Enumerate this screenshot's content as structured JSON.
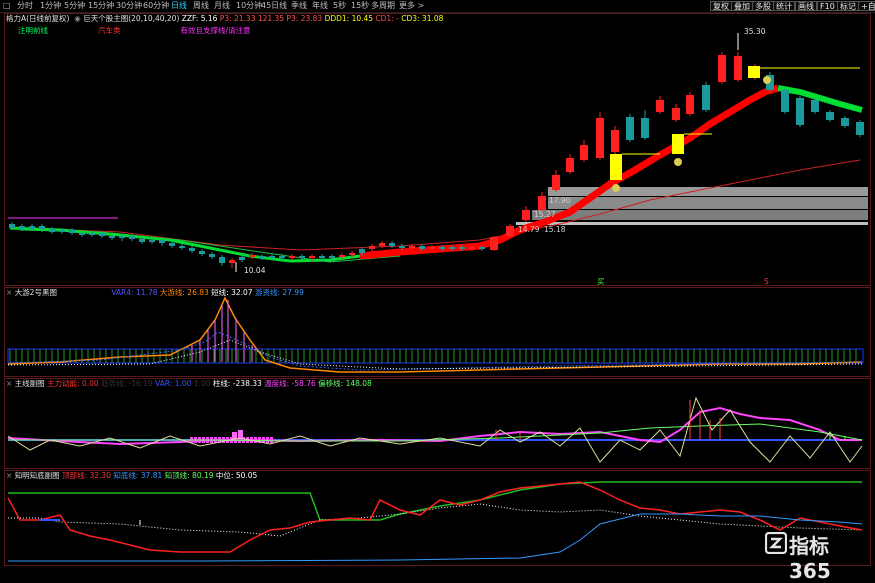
{
  "toolbar": {
    "left_icon": "□",
    "periods": [
      "分时",
      "1分钟",
      "5分钟",
      "15分钟",
      "30分钟",
      "60分钟",
      "日线",
      "周线",
      "月线",
      "10分钟",
      "45日线",
      "季线",
      "年线",
      "5秒",
      "15秒",
      "多周期",
      "更多 >"
    ],
    "active_period": "日线",
    "right_buttons": [
      "复权",
      "叠加",
      "多股",
      "统计",
      "画线",
      "F10",
      "标记",
      "+自"
    ]
  },
  "main_panel": {
    "stock_label": "格力A(日线前复权)",
    "title": "巨天个股主图(20,10,40,20)",
    "values": [
      {
        "text": "ZZF: 5.16",
        "color": "#ffffff"
      },
      {
        "text": "P3: 21.33",
        "color": "#ff5050"
      },
      {
        "text": "121.35",
        "color": "#ff5050"
      },
      {
        "text": "P3: 23.83",
        "color": "#ff5050"
      },
      {
        "text": "DDD1: 10.45",
        "color": "#ffff00"
      },
      {
        "text": "CD1: -",
        "color": "#ff5050"
      },
      {
        "text": "CD3: 31.08",
        "color": "#ffff00"
      }
    ],
    "sub_labels": [
      {
        "text": "注明前线",
        "color": "#00ff66"
      },
      {
        "text": "汽车类",
        "color": "#ff3333"
      },
      {
        "text": "有效且支撑线/请注意",
        "color": "#ff33ff"
      }
    ],
    "price_labels": {
      "high": "35.30",
      "low": "10.04",
      "flat_a": "17.90",
      "flat_b": "15.27",
      "flat_c": "14.79",
      "flat_d": "15.18"
    },
    "markers": {
      "buy": "买",
      "sell": "S"
    }
  },
  "panel2": {
    "title": "大游2号黑图",
    "values": [
      {
        "text": "VAR4: 11.78",
        "color": "#5555ff"
      },
      {
        "text": "大游线: 26.83",
        "color": "#ff8800"
      },
      {
        "text": "短线: 32.07",
        "color": "#ffffff"
      },
      {
        "text": "游资线: 27.99",
        "color": "#3399ff"
      }
    ]
  },
  "panel3": {
    "title": "主线副图",
    "values": [
      {
        "text": "主力动能: 0.00",
        "color": "#ff3333"
      },
      {
        "text": "趋势线: -16.19",
        "color": "#333333"
      },
      {
        "text": "VAR: 1.00",
        "color": "#3355ff"
      },
      {
        "text": "1.00",
        "color": "#333333"
      },
      {
        "text": "柱线: -238.33",
        "color": "#ffffff"
      },
      {
        "text": "温度线: -58.76",
        "color": "#ff44ff"
      },
      {
        "text": "偏移线: 148.08",
        "color": "#66ff66"
      }
    ]
  },
  "panel4": {
    "title": "知明知底副图",
    "values": [
      {
        "text": "顶部线: 32.30",
        "color": "#ff3333"
      },
      {
        "text": "知底线: 37.81",
        "color": "#3399ff"
      },
      {
        "text": "知顶线: 80.19",
        "color": "#66ff66"
      },
      {
        "text": "中位: 50.05",
        "color": "#ffffff"
      }
    ]
  },
  "watermark": {
    "text": "指标365"
  },
  "colors": {
    "up": "#ff2020",
    "down": "#1a9a9a",
    "ribbon_up": "#ff0000",
    "ribbon_down": "#00dd33",
    "yellow": "#ffff00"
  }
}
